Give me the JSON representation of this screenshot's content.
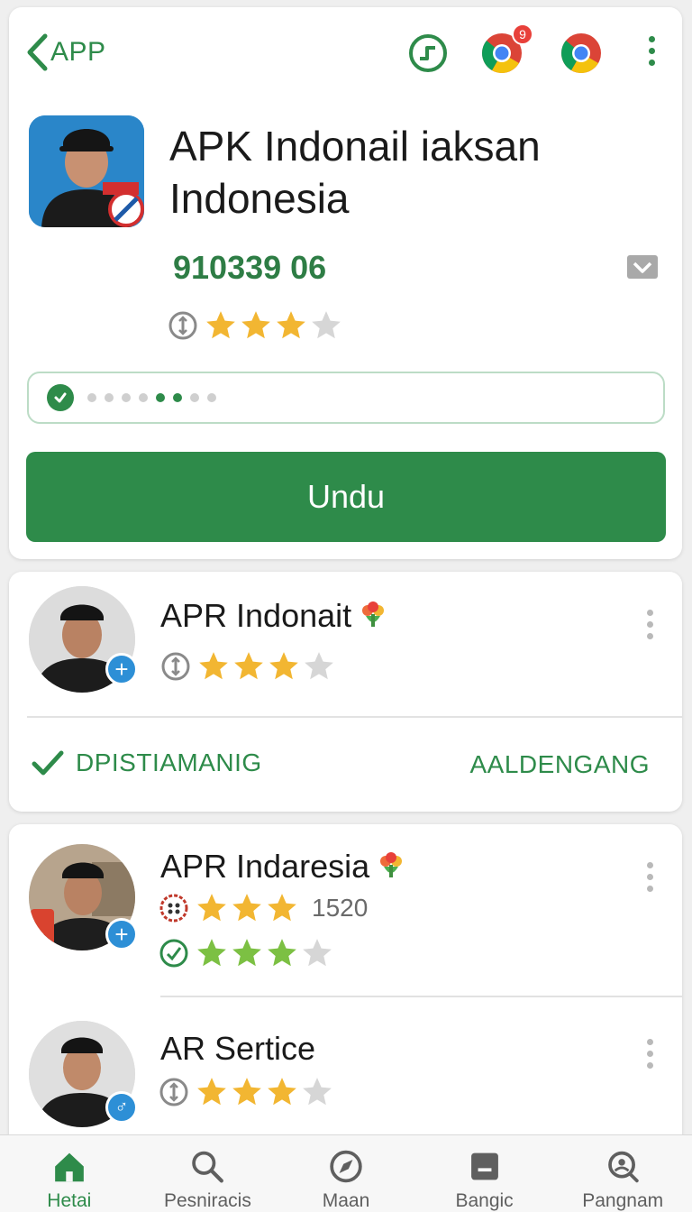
{
  "header": {
    "back_label": "APP",
    "notification_badge": "9"
  },
  "app": {
    "title": "APK Indonail iaksan Indonesia",
    "code": "910339 06",
    "rating_stars": 3,
    "rating_max": 4,
    "install_progress": {
      "total_steps": 8,
      "active_steps": [
        5,
        6
      ]
    },
    "download_label": "Undu"
  },
  "card_publisher": {
    "title": "APR Indonait",
    "rating_stars": 3,
    "rating_max": 4,
    "action_left": "DPISTIAMANIG",
    "action_right": "AALDENGANG"
  },
  "card_list": {
    "items": [
      {
        "title": "APR Indaresia",
        "rating_stars": 3,
        "rating_max": 3,
        "rating_count": "1520",
        "secondary_stars": 3,
        "secondary_max": 4
      },
      {
        "title": "AR Sertice",
        "rating_stars": 3,
        "rating_max": 4
      }
    ]
  },
  "bottom_nav": {
    "items": [
      {
        "label": "Hetai",
        "icon": "home-icon",
        "active": true
      },
      {
        "label": "Pesniracis",
        "icon": "search-icon",
        "active": false
      },
      {
        "label": "Maan",
        "icon": "compass-icon",
        "active": false
      },
      {
        "label": "Bangic",
        "icon": "inbox-icon",
        "active": false
      },
      {
        "label": "Pangnam",
        "icon": "account-search-icon",
        "active": false
      }
    ]
  },
  "colors": {
    "accent": "#2e8b4a",
    "star": "#f2b632",
    "star_green": "#7cc043",
    "star_empty": "#d6d6d6",
    "badge": "#e8403a"
  }
}
